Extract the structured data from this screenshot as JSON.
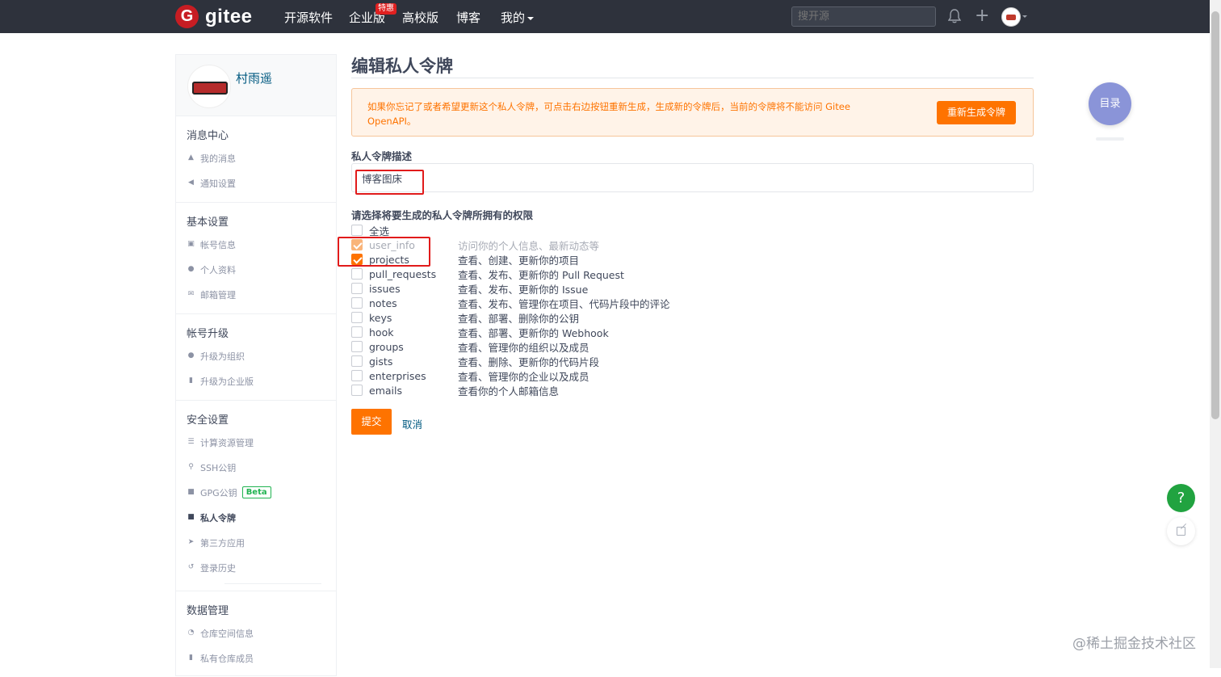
{
  "nav": {
    "brand": "gitee",
    "logo_letter": "G",
    "items": [
      {
        "label": "开源软件"
      },
      {
        "label": "企业版"
      },
      {
        "label": "高校版"
      },
      {
        "label": "博客"
      },
      {
        "label": "我的"
      }
    ],
    "enterprise_badge": "特惠",
    "search_placeholder": "搜开源"
  },
  "sidebar": {
    "username": "村雨遥",
    "sections": [
      {
        "title": "消息中心",
        "items": [
          {
            "label": "我的消息",
            "icon": "bell-icon"
          },
          {
            "label": "通知设置",
            "icon": "volume-icon"
          }
        ]
      },
      {
        "title": "基本设置",
        "items": [
          {
            "label": "帐号信息",
            "icon": "id-card-icon"
          },
          {
            "label": "个人资料",
            "icon": "user-icon"
          },
          {
            "label": "邮箱管理",
            "icon": "mail-icon"
          }
        ]
      },
      {
        "title": "帐号升级",
        "items": [
          {
            "label": "升级为组织",
            "icon": "group-icon"
          },
          {
            "label": "升级为企业版",
            "icon": "building-icon"
          }
        ]
      },
      {
        "title": "安全设置",
        "items": [
          {
            "label": "计算资源管理",
            "icon": "server-icon"
          },
          {
            "label": "SSH公钥",
            "icon": "key-icon"
          },
          {
            "label": "GPG公钥",
            "icon": "lock-icon",
            "badge": "Beta"
          },
          {
            "label": "私人令牌",
            "icon": "lock-icon",
            "active": true
          },
          {
            "label": "第三方应用",
            "icon": "rocket-icon"
          },
          {
            "label": "登录历史",
            "icon": "history-icon"
          }
        ]
      },
      {
        "title": "数据管理",
        "items": [
          {
            "label": "仓库空间信息",
            "icon": "pie-chart-icon"
          },
          {
            "label": "私有仓库成员",
            "icon": "building-icon"
          }
        ]
      }
    ]
  },
  "main": {
    "title": "编辑私人令牌",
    "alert_text": "如果你忘记了或者希望更新这个私人令牌，可点击右边按钮重新生成，生成新的令牌后，当前的令牌将不能访问 Gitee OpenAPI。",
    "regenerate_label": "重新生成令牌",
    "desc_label": "私人令牌描述",
    "desc_value": "博客图床",
    "perm_label": "请选择将要生成的私人令牌所拥有的权限",
    "select_all": "全选",
    "permissions": [
      {
        "name": "user_info",
        "desc": "访问你的个人信息、最新动态等",
        "checked": true,
        "disabled": true
      },
      {
        "name": "projects",
        "desc": "查看、创建、更新你的项目",
        "checked": true,
        "disabled": false
      },
      {
        "name": "pull_requests",
        "desc": "查看、发布、更新你的 Pull Request",
        "checked": false
      },
      {
        "name": "issues",
        "desc": "查看、发布、更新你的 Issue",
        "checked": false
      },
      {
        "name": "notes",
        "desc": "查看、发布、管理你在项目、代码片段中的评论",
        "checked": false
      },
      {
        "name": "keys",
        "desc": "查看、部署、删除你的公钥",
        "checked": false
      },
      {
        "name": "hook",
        "desc": "查看、部署、更新你的 Webhook",
        "checked": false
      },
      {
        "name": "groups",
        "desc": "查看、管理你的组织以及成员",
        "checked": false
      },
      {
        "name": "gists",
        "desc": "查看、删除、更新你的代码片段",
        "checked": false
      },
      {
        "name": "enterprises",
        "desc": "查看、管理你的企业以及成员",
        "checked": false
      },
      {
        "name": "emails",
        "desc": "查看你的个人邮箱信息",
        "checked": false
      }
    ],
    "submit_label": "提交",
    "cancel_label": "取消"
  },
  "floating": {
    "toc_label": "目录",
    "help_label": "?"
  },
  "watermark": "@稀土掘金技术社区",
  "colors": {
    "accent": "#fe7300",
    "nav_bg": "#2e323c",
    "link": "#005980",
    "annotation_red": "#e11b1b"
  }
}
